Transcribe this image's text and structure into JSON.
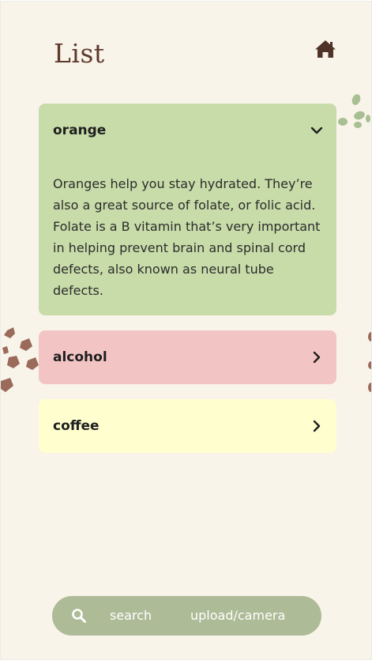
{
  "page": {
    "title": "List",
    "home_icon": "home-icon"
  },
  "accordions": [
    {
      "title": "orange",
      "expanded": true,
      "color": "#c8dca9",
      "body": "Oranges help you stay hydrated. They’re also a great source of folate, or folic acid. Folate is a B vitamin that’s very important in helping prevent brain and spinal cord defects, also known as neural tube defects.",
      "chevron": "chevron-down-icon"
    },
    {
      "title": "alcohol",
      "expanded": false,
      "color": "#f2c5c4",
      "chevron": "chevron-right-icon"
    },
    {
      "title": "coffee",
      "expanded": false,
      "color": "#fefece",
      "chevron": "chevron-right-icon"
    }
  ],
  "bottom_bar": {
    "search_icon": "search-icon",
    "search_label": "search",
    "upload_label": "upload/camera",
    "color": "#adbb97"
  },
  "colors": {
    "background": "#f9f4ea",
    "title": "#5d3a2c"
  }
}
